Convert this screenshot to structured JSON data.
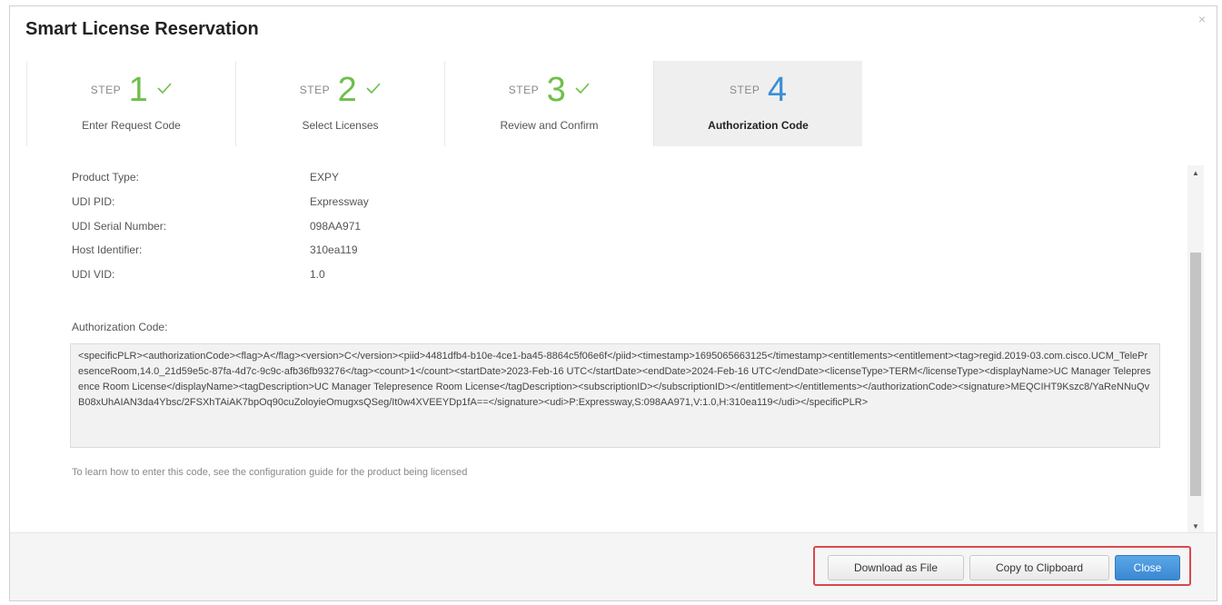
{
  "dialog": {
    "title": "Smart License Reservation",
    "close_icon": "×"
  },
  "steps": [
    {
      "word": "STEP",
      "number": "1",
      "label": "Enter Request Code",
      "completed": true
    },
    {
      "word": "STEP",
      "number": "2",
      "label": "Select Licenses",
      "completed": true
    },
    {
      "word": "STEP",
      "number": "3",
      "label": "Review and Confirm",
      "completed": true
    },
    {
      "word": "STEP",
      "number": "4",
      "label": "Authorization Code",
      "completed": false,
      "active": true
    }
  ],
  "details": [
    {
      "label": "Product Type:",
      "value": "EXPY"
    },
    {
      "label": "UDI PID:",
      "value": "Expressway"
    },
    {
      "label": "UDI Serial Number:",
      "value": "098AA971"
    },
    {
      "label": "Host Identifier:",
      "value": "310ea119"
    },
    {
      "label": "UDI VID:",
      "value": "1.0"
    }
  ],
  "authorization": {
    "label": "Authorization Code:",
    "code": "<specificPLR><authorizationCode><flag>A</flag><version>C</version><piid>4481dfb4-b10e-4ce1-ba45-8864c5f06e6f</piid><timestamp>1695065663125</timestamp><entitlements><entitlement><tag>regid.2019-03.com.cisco.UCM_TelePresenceRoom,14.0_21d59e5c-87fa-4d7c-9c9c-afb36fb93276</tag><count>1</count><startDate>2023-Feb-16 UTC</startDate><endDate>2024-Feb-16 UTC</endDate><licenseType>TERM</licenseType><displayName>UC Manager Telepresence Room License</displayName><tagDescription>UC Manager Telepresence Room License</tagDescription><subscriptionID></subscriptionID></entitlement></entitlements></authorizationCode><signature>MEQCIHT9Kszc8/YaReNNuQvB08xUhAIAN3da4Ybsc/2FSXhTAiAK7bpOq90cuZoloyieOmugxsQSeg/It0w4XVEEYDp1fA==</signature><udi>P:Expressway,S:098AA971,V:1.0,H:310ea119</udi></specificPLR>",
    "hint": "To learn how to enter this code, see the configuration guide for the product being licensed"
  },
  "footer": {
    "download_label": "Download as File",
    "copy_label": "Copy to Clipboard",
    "close_label": "Close"
  },
  "colors": {
    "step_complete": "#6fbf4a",
    "step_active": "#3b8fd6",
    "highlight": "#d9484f",
    "primary_button": "#3a88d2"
  },
  "icons": {
    "step_check": "checkmark-icon",
    "scroll_up": "scroll-up-arrow-icon",
    "scroll_down": "scroll-down-arrow-icon",
    "close": "close-icon"
  }
}
